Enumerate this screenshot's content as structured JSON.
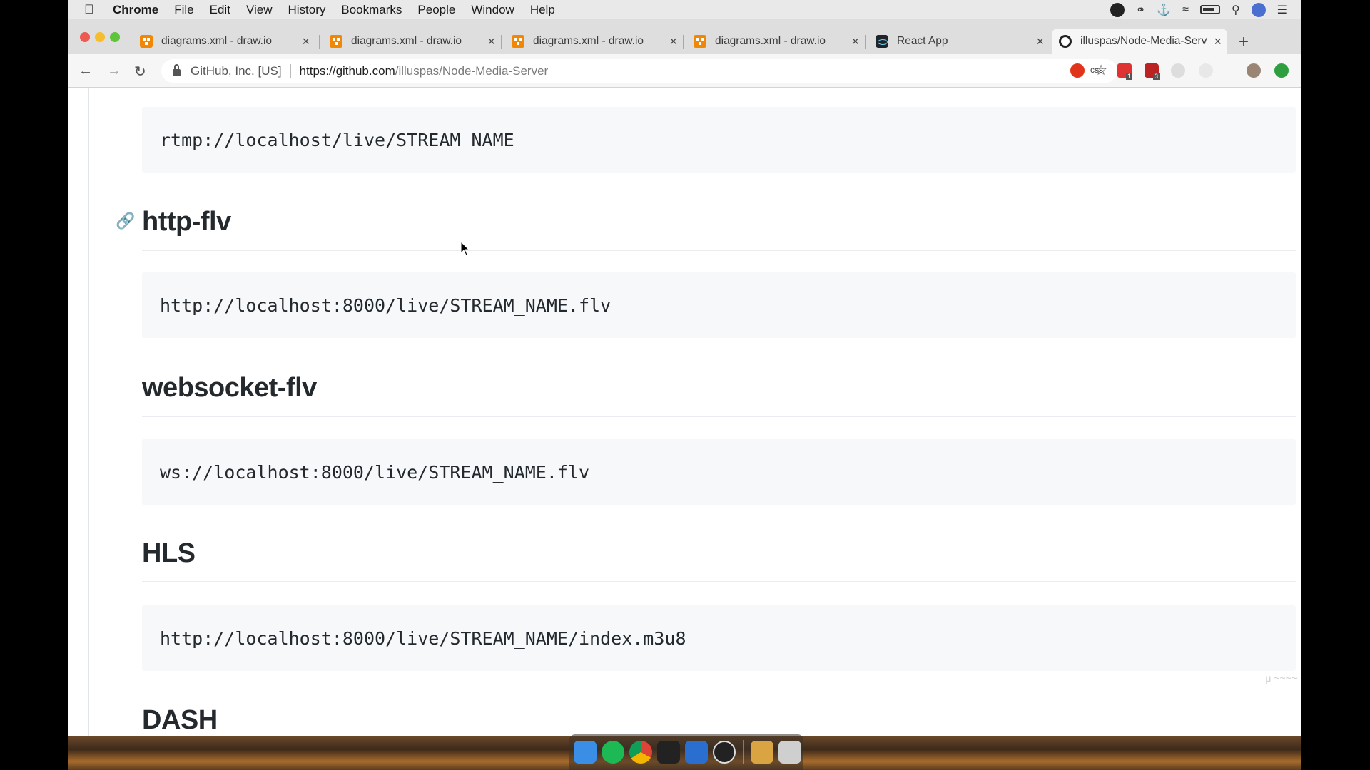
{
  "menubar": {
    "app": "Chrome",
    "items": [
      "File",
      "Edit",
      "View",
      "History",
      "Bookmarks",
      "People",
      "Window",
      "Help"
    ]
  },
  "tabs": [
    {
      "label": "diagrams.xml - draw.io",
      "icon": "drawio-icon"
    },
    {
      "label": "diagrams.xml - draw.io",
      "icon": "drawio-icon"
    },
    {
      "label": "diagrams.xml - draw.io",
      "icon": "drawio-icon"
    },
    {
      "label": "diagrams.xml - draw.io",
      "icon": "drawio-icon"
    },
    {
      "label": "React App",
      "icon": "react-icon"
    },
    {
      "label": "illuspas/Node-Media-Serv",
      "icon": "github-icon"
    }
  ],
  "omnibox": {
    "org": "GitHub, Inc. [US]",
    "scheme_host": "https://github.com",
    "path": "/illuspas/Node-Media-Server"
  },
  "extensions": {
    "css_label": "css",
    "badge_a": "1",
    "badge_b": "3"
  },
  "content": {
    "rtmp_url": "rtmp://localhost/live/STREAM_NAME",
    "sections": [
      {
        "heading": "http-flv",
        "url": "http://localhost:8000/live/STREAM_NAME.flv"
      },
      {
        "heading": "websocket-flv",
        "url": "ws://localhost:8000/live/STREAM_NAME.flv"
      },
      {
        "heading": "HLS",
        "url": "http://localhost:8000/live/STREAM_NAME/index.m3u8"
      },
      {
        "heading": "DASH"
      }
    ]
  },
  "colors": {
    "code_bg": "#f6f8fa",
    "text": "#24292e",
    "rule": "#eaecef"
  }
}
